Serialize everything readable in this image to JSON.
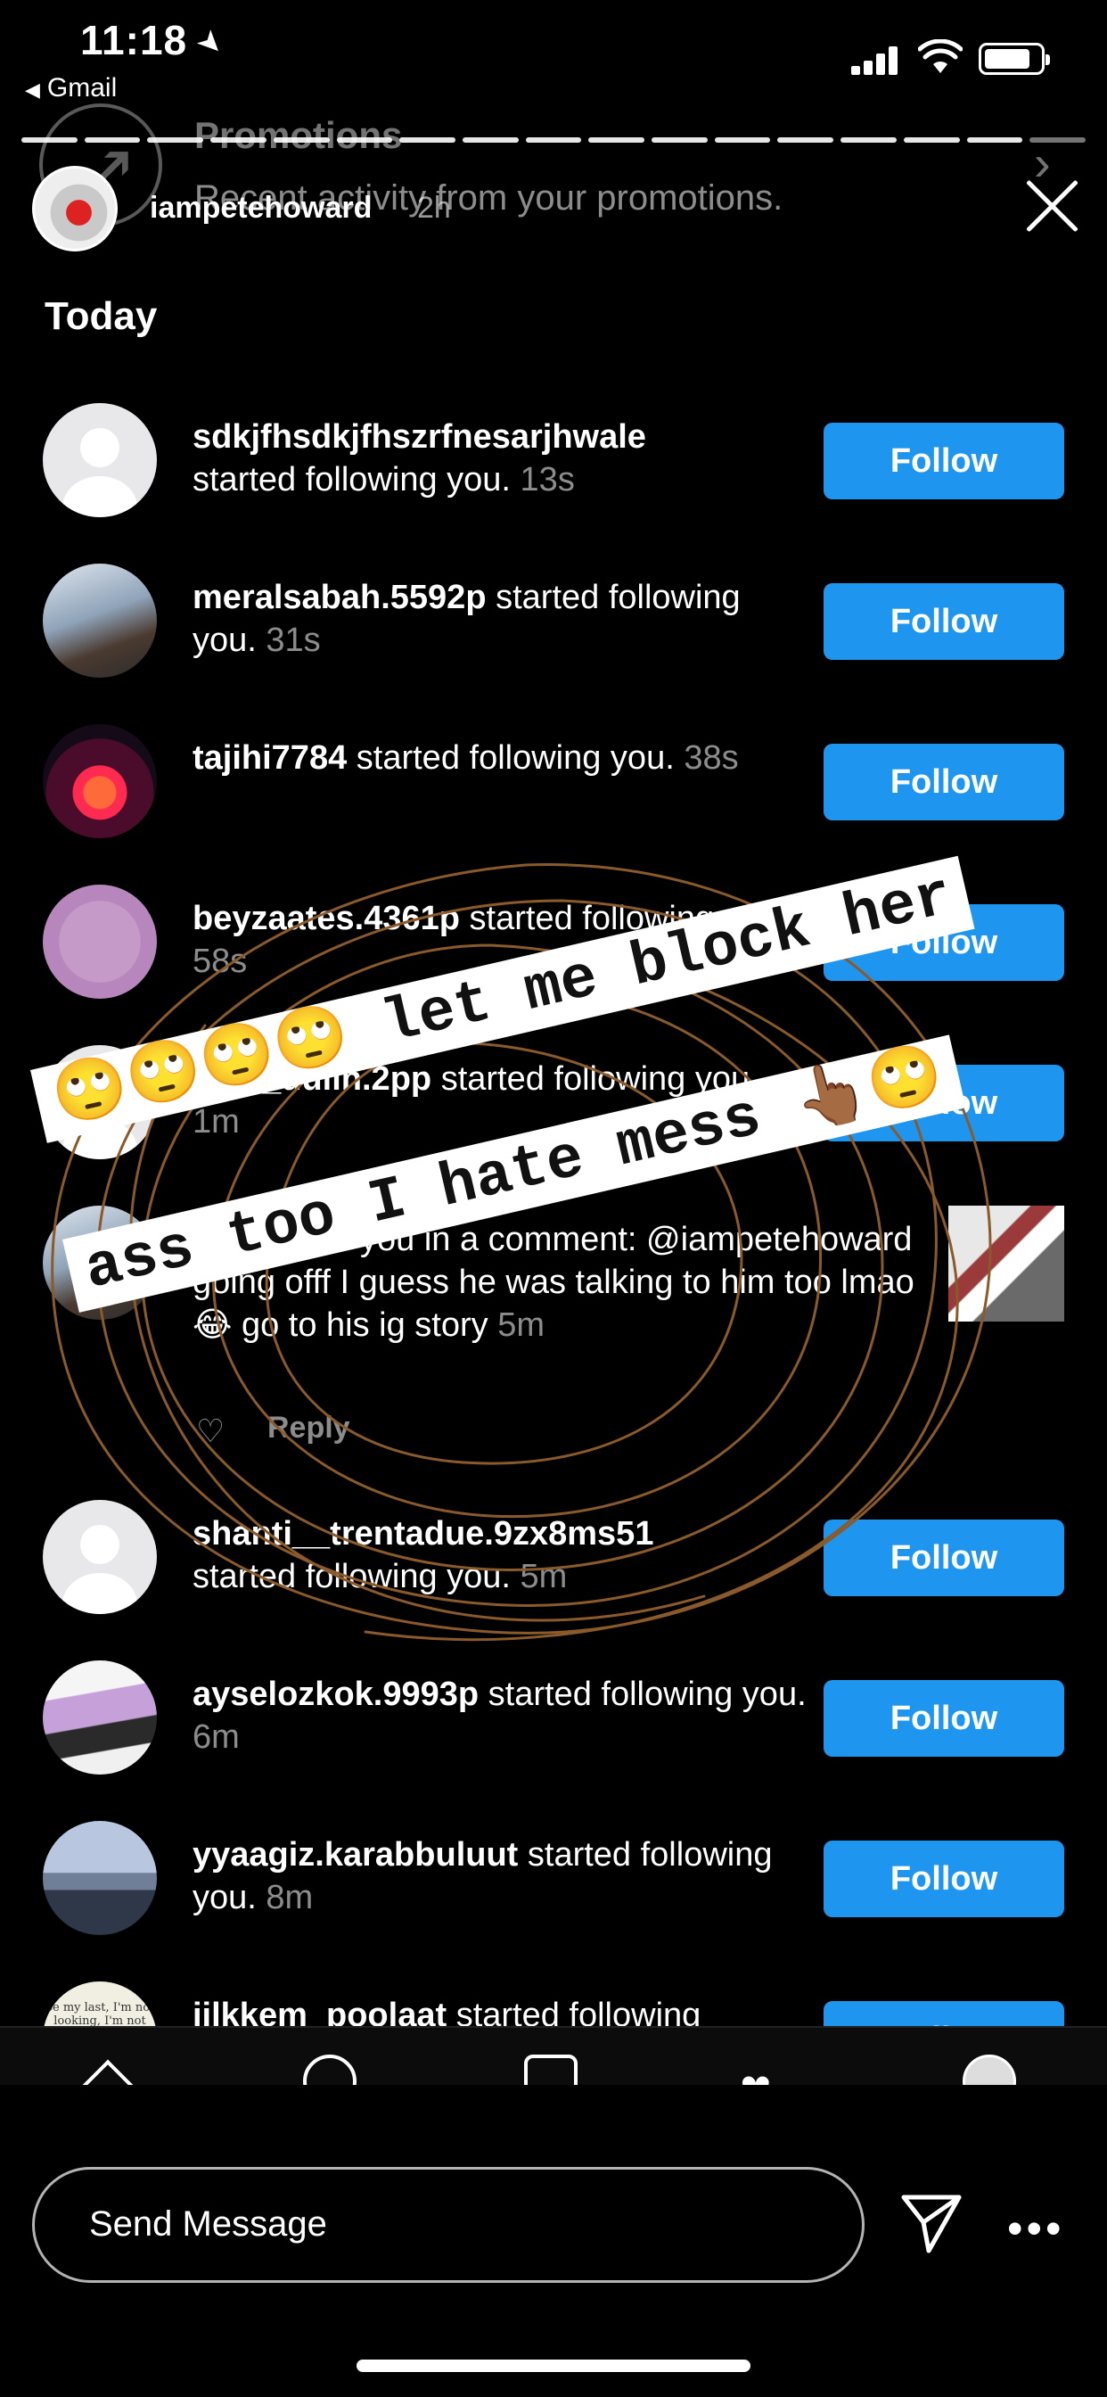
{
  "status_bar": {
    "time": "11:18",
    "location_arrow": "➤",
    "back_app": "Gmail",
    "back_glyph": "◀"
  },
  "gmail_banner": {
    "title": "Promotions",
    "subtitle": "Recent activity from your promotions.",
    "chevron": "›"
  },
  "story": {
    "username": "iampetehoward",
    "posted_ago": "2h",
    "progress_segments": 17,
    "progress_done": 16
  },
  "activity": {
    "section_title": "Today",
    "follow_label": "Follow",
    "rows": [
      {
        "username": "sdkjfhsdkjfhszrfnesarjhwale",
        "action": "started following you.",
        "time": "13s"
      },
      {
        "username": "meralsabah.5592p",
        "action": "started following you.",
        "time": "31s"
      },
      {
        "username": "tajihi7784",
        "action": "started following you.",
        "time": "38s"
      },
      {
        "username": "beyzaates.4361p",
        "action": "started following you.",
        "time": "58s"
      },
      {
        "username": "juan_dulin.2pp",
        "action": "started following you.",
        "time": "1m"
      },
      {
        "username": "shanti__trentadue.9zx8ms51",
        "action": "started following you.",
        "time": "5m"
      },
      {
        "username": "ayselozkok.9993p",
        "action": "started following you.",
        "time": "6m"
      },
      {
        "username": "yyaagiz.karabbuluut",
        "action": "started following you.",
        "time": "8m"
      },
      {
        "username": "iilkkem_poolaat",
        "action": "started following",
        "time": ""
      }
    ],
    "mention": {
      "username": "",
      "text": "mentioned you in a comment: @iampetehoward  going offf I guess he was talking to him too lmao 😂 go to his ig story",
      "time": "5m",
      "reply_label": "Reply",
      "heart_glyph": "♡"
    },
    "paper_avatar_text": "be my last, I'm not looking, I'm not"
  },
  "sticker": {
    "line1": "🙄🙄🙄🙄 let me block her",
    "line2": "ass too I hate mess 👆🏾🙄",
    "ink_color": "#8a5a2a"
  },
  "reply_bar": {
    "placeholder": "Send Message",
    "more_glyph": "•••"
  },
  "icons": {
    "close": "close-icon",
    "send": "paper-plane-icon",
    "more": "more-icon",
    "heart": "heart-icon"
  },
  "colors": {
    "follow_button": "#1e96f0",
    "background": "#000000",
    "scribble": "#8a5a2a"
  }
}
